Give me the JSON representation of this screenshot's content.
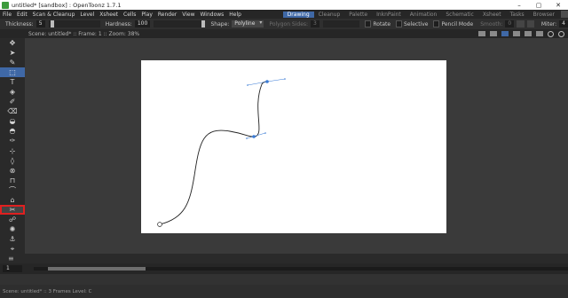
{
  "window": {
    "title": "untitled* [sandbox] : OpenToonz 1.7.1",
    "controls": [
      "–",
      "▢",
      "✕"
    ]
  },
  "menubar": {
    "menus": [
      "File",
      "Edit",
      "Scan & Cleanup",
      "Level",
      "Xsheet",
      "Cells",
      "Play",
      "Render",
      "View",
      "Windows",
      "Help"
    ],
    "rooms": [
      "Drawing",
      "Cleanup",
      "Palette",
      "InknPaint",
      "Animation",
      "Schematic",
      "Xsheet",
      "Tasks",
      "Browser"
    ],
    "active_room": "Drawing"
  },
  "tool_options": {
    "thickness_label": "Thickness:",
    "thickness_value": "5",
    "hardness_label": "Hardness:",
    "hardness_value": "100",
    "shape_label": "Shape:",
    "shape_value": "Polyline",
    "polygon_sides_label": "Polygon Sides:",
    "polygon_sides_value": "3",
    "rotate_label": "Rotate",
    "selective_label": "Selective",
    "pencil_mode_label": "Pencil Mode",
    "smooth_label": "Smooth:",
    "smooth_value": "0",
    "miter_label": "Miter:",
    "miter_value": "4"
  },
  "viewer": {
    "info": "Scene: untitled*  ::  Frame: 1  ::  Zoom: 38%"
  },
  "toolbar": {
    "tools": [
      {
        "name": "animate-tool-icon",
        "glyph": "✥"
      },
      {
        "name": "selection-tool-icon",
        "glyph": "➤"
      },
      {
        "name": "brush-tool-icon",
        "glyph": "✎"
      },
      {
        "name": "geometric-tool-icon",
        "glyph": "⬚"
      },
      {
        "name": "type-tool-icon",
        "glyph": "T"
      },
      {
        "name": "fill-tool-icon",
        "glyph": "◈"
      },
      {
        "name": "paint-brush-tool-icon",
        "glyph": "✐"
      },
      {
        "name": "eraser-tool-icon",
        "glyph": "⌫"
      },
      {
        "name": "tape-tool-icon",
        "glyph": "◒"
      },
      {
        "name": "style-picker-tool-icon",
        "glyph": "◓"
      },
      {
        "name": "rgb-picker-tool-icon",
        "glyph": "✑"
      },
      {
        "name": "control-point-editor-icon",
        "glyph": "⊹"
      },
      {
        "name": "pinch-tool-icon",
        "glyph": "◊"
      },
      {
        "name": "pump-tool-icon",
        "glyph": "⊗"
      },
      {
        "name": "magnet-tool-icon",
        "glyph": "⊓"
      },
      {
        "name": "bender-tool-icon",
        "glyph": "⌒"
      },
      {
        "name": "iron-tool-icon",
        "glyph": "⌂"
      },
      {
        "name": "cutter-tool-icon",
        "glyph": "✂"
      },
      {
        "name": "skeleton-tool-icon",
        "glyph": "☍"
      },
      {
        "name": "tracker-tool-icon",
        "glyph": "✺"
      },
      {
        "name": "hook-tool-icon",
        "glyph": "⚓"
      },
      {
        "name": "plastic-tool-icon",
        "glyph": "⌖"
      }
    ],
    "active_index": 3,
    "highlighted_index": 17
  },
  "xsheet": {
    "frame_value": "1"
  },
  "status": {
    "text": "Scene: untitled*  ::  3 Frames  Level: C"
  },
  "colors": {
    "accent": "#3f68a6",
    "highlight": "#e02020",
    "stroke": "#222222",
    "control_point": "#3a7bd5"
  }
}
